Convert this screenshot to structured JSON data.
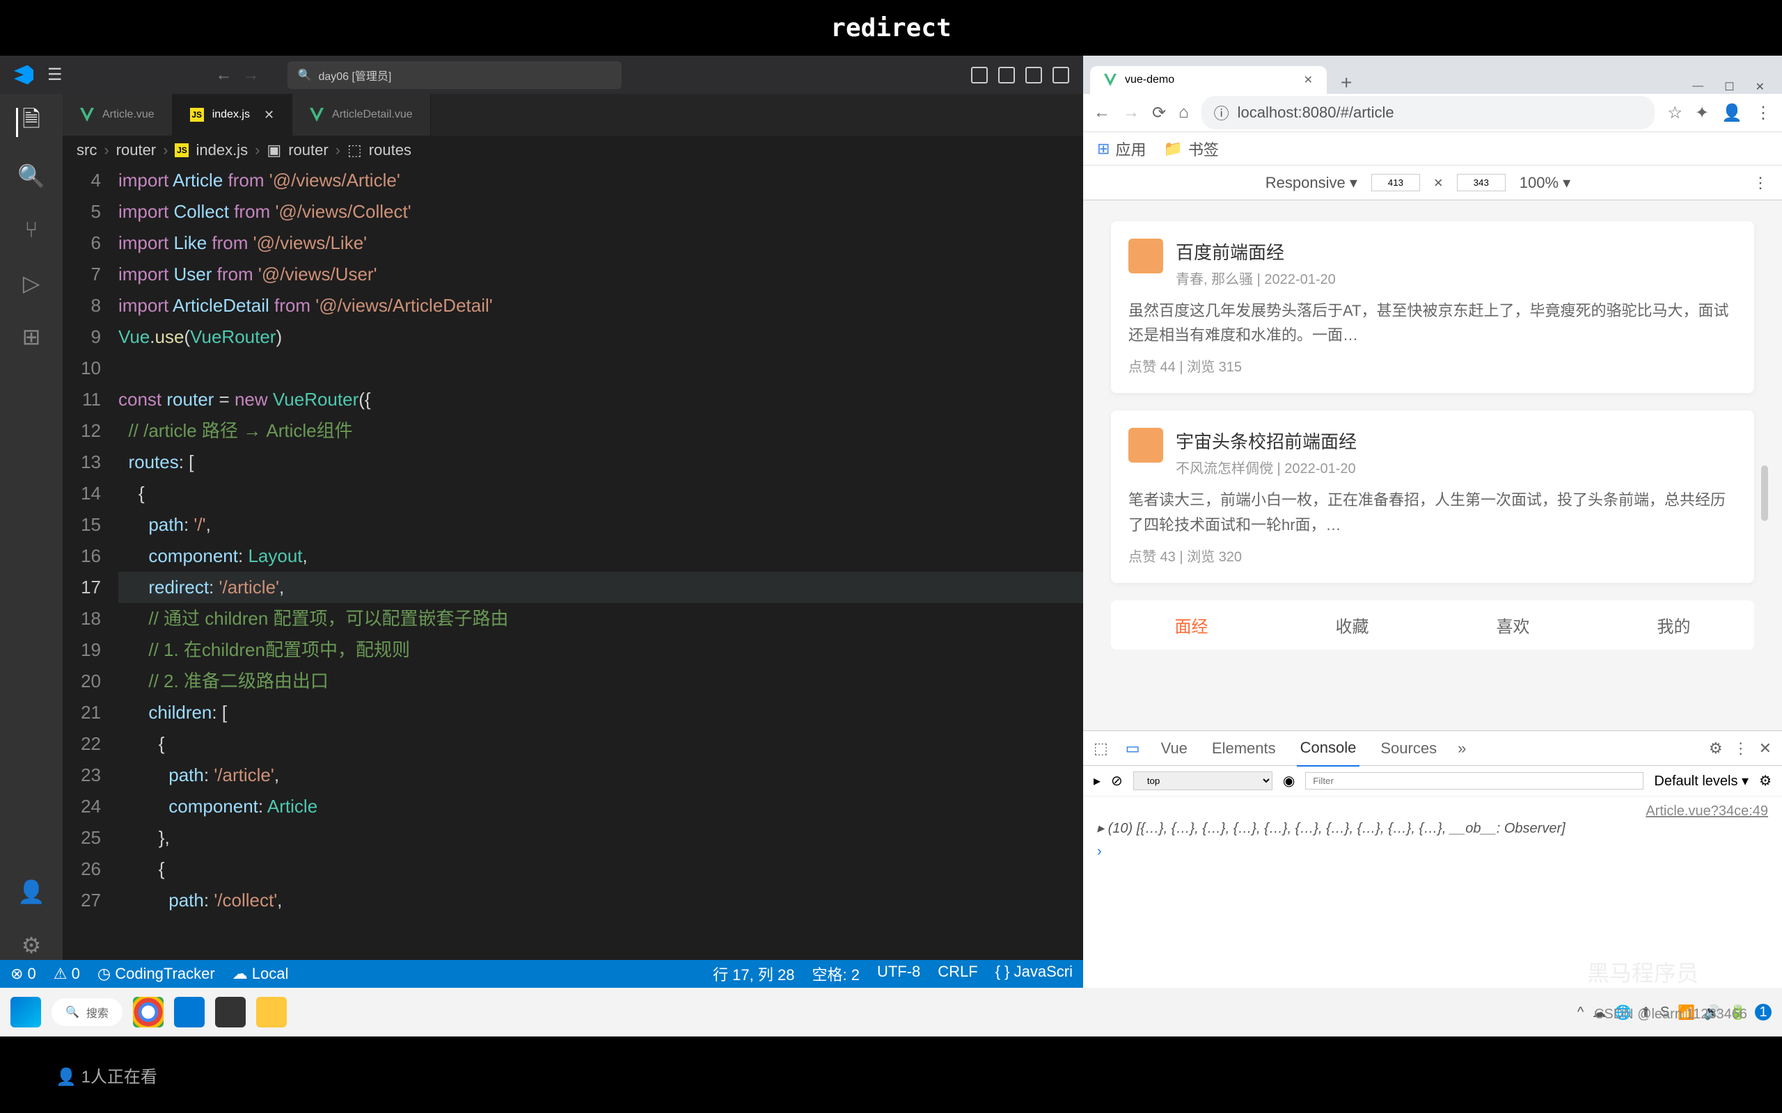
{
  "banner": "redirect",
  "vscode": {
    "search": "day06 [管理员]",
    "tabs": [
      {
        "icon": "vue",
        "label": "Article.vue",
        "active": false
      },
      {
        "icon": "js",
        "label": "index.js",
        "active": true,
        "closable": true
      },
      {
        "icon": "vue",
        "label": "ArticleDetail.vue",
        "active": false
      }
    ],
    "breadcrumb": [
      "src",
      "router",
      "index.js",
      "router",
      "routes"
    ],
    "lines": {
      "4": "import Article from '@/views/Article'",
      "5": "import Collect from '@/views/Collect'",
      "6": "import Like from '@/views/Like'",
      "7": "import User from '@/views/User'",
      "8": "import ArticleDetail from '@/views/ArticleDetail'",
      "9": "Vue.use(VueRouter)",
      "10": "",
      "11": "const router = new VueRouter({",
      "12": "  // /article 路径 → Article组件",
      "13": "  routes: [",
      "14": "    {",
      "15": "      path: '/',",
      "16": "      component: Layout,",
      "17": "      redirect: '/article',",
      "18": "      // 通过 children 配置项，可以配置嵌套子路由",
      "19": "      // 1. 在children配置项中，配规则",
      "20": "      // 2. 准备二级路由出口",
      "21": "      children: [",
      "22": "        {",
      "23": "          path: '/article',",
      "24": "          component: Article",
      "25": "        },",
      "26": "        {",
      "27": "          path: '/collect',"
    },
    "current_line": 17,
    "status": {
      "errors": "0",
      "warnings": "0",
      "tracker": "CodingTracker",
      "local": "Local",
      "pos": "行 17, 列 28",
      "spaces": "空格: 2",
      "encoding": "UTF-8",
      "eol": "CRLF",
      "lang": "JavaScri"
    }
  },
  "browser": {
    "tab_title": "vue-demo",
    "url": "localhost:8080/#/article",
    "bookmarks": {
      "apps": "应用",
      "bm": "书签"
    },
    "responsive": {
      "label": "Responsive",
      "w": "413",
      "h": "343",
      "zoom": "100%"
    },
    "articles": [
      {
        "title": "百度前端面经",
        "meta": "青春, 那么骚 | 2022-01-20",
        "body": "虽然百度这几年发展势头落后于AT，甚至快被京东赶上了，毕竟瘦死的骆驼比马大，面试还是相当有难度和水准的。一面…",
        "stats": "点赞 44 | 浏览 315"
      },
      {
        "title": "宇宙头条校招前端面经",
        "meta": "不风流怎样倜傥 | 2022-01-20",
        "body": "笔者读大三，前端小白一枚，正在准备春招，人生第一次面试，投了头条前端，总共经历了四轮技术面试和一轮hr面，…",
        "stats": "点赞 43 | 浏览 320"
      }
    ],
    "nav_tabs": [
      "面经",
      "收藏",
      "喜欢",
      "我的"
    ],
    "devtools": {
      "tabs": [
        "Vue",
        "Elements",
        "Console",
        "Sources"
      ],
      "active_tab": "Console",
      "context": "top",
      "filter_ph": "Filter",
      "levels": "Default levels",
      "source": "Article.vue?34ce:49",
      "output": "(10) [{…}, {…}, {…}, {…}, {…}, {…}, {…}, {…}, {…}, {…}, __ob__: Observer]"
    }
  },
  "taskbar": {
    "search": "搜索",
    "viewers": "1人正在看"
  },
  "watermark": "CSDN @learn 11233466",
  "watermark2": "黑马程序员"
}
